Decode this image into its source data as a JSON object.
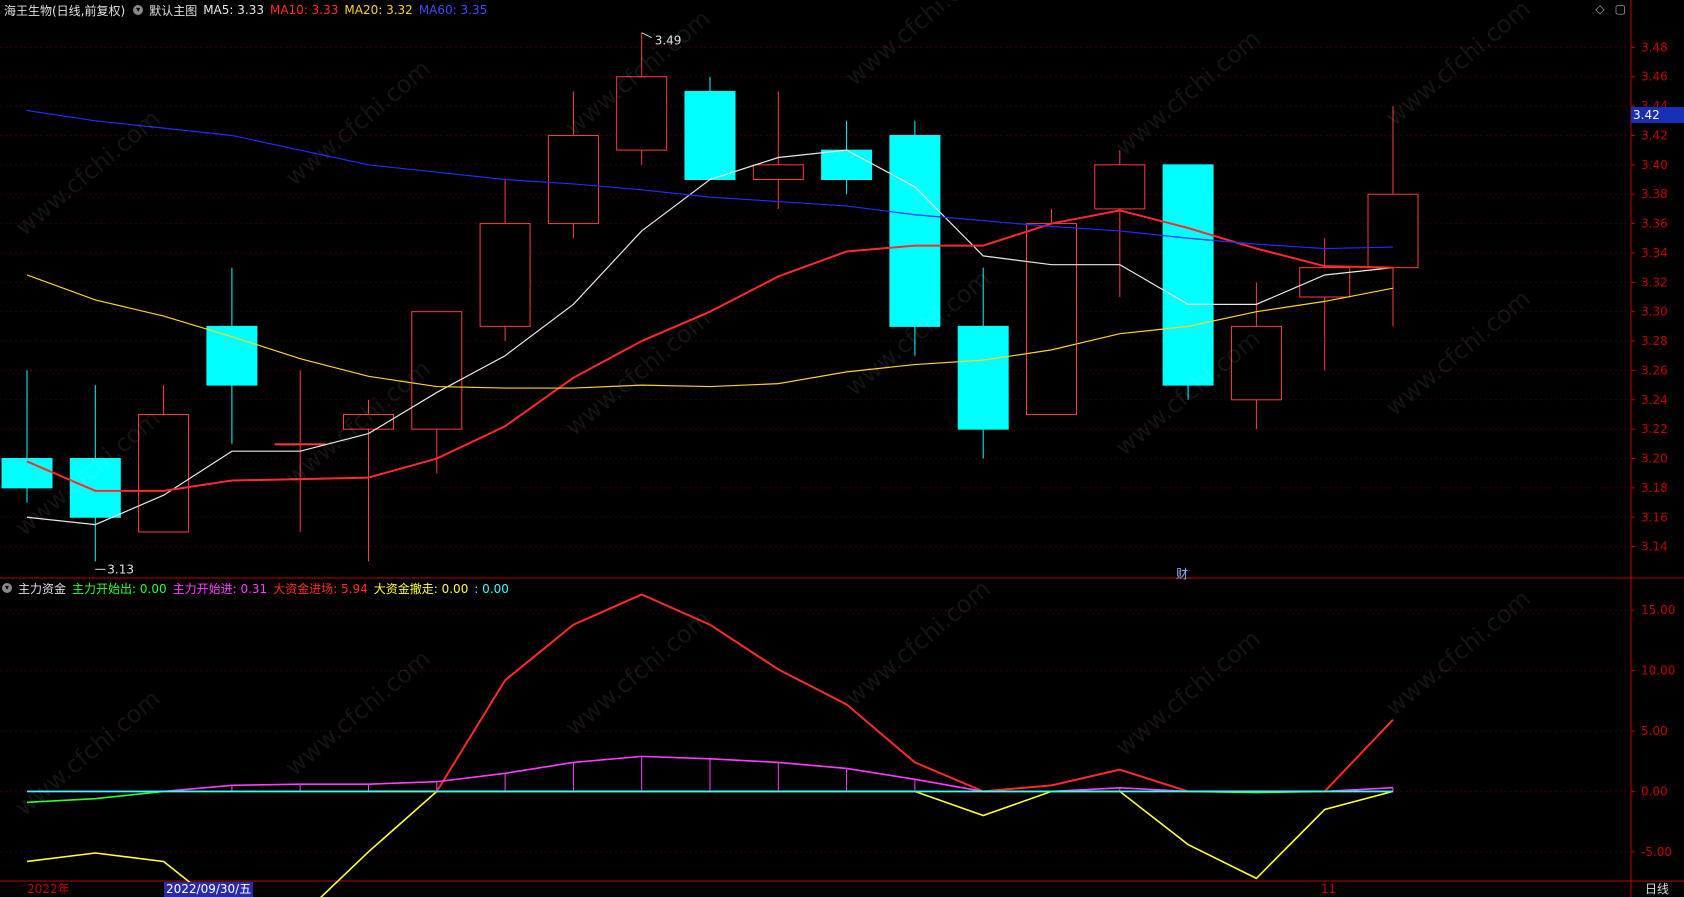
{
  "header": {
    "stock": "海王生物(日线,前复权)",
    "main_indicator": "默认主图",
    "ma_items": [
      {
        "label": "MA5: 3.33",
        "color": "#e8e8e8"
      },
      {
        "label": "MA10: 3.33",
        "color": "#ff2a2a"
      },
      {
        "label": "MA20: 3.32",
        "color": "#ffd21e"
      },
      {
        "label": "MA60: 3.35",
        "color": "#3a4cff"
      }
    ],
    "icons": [
      "diamond-icon",
      "window-icon"
    ]
  },
  "sub_header": {
    "indicator": "主力资金",
    "items": [
      {
        "label": "主力开始出: 0.00",
        "color": "#2dff2d"
      },
      {
        "label": "主力开始进: 0.31",
        "color": "#ff3cff"
      },
      {
        "label": "大资金进场: 5.94",
        "color": "#ff2a2a"
      },
      {
        "label": "大资金撤走: 0.00",
        "color": "#ffff33"
      },
      {
        "label": ": 0.00",
        "color": "#33ffff"
      }
    ]
  },
  "current_price": "3.42",
  "high_label": "3.49",
  "low_label": "3.13",
  "finance_marker": "财",
  "bottom": {
    "year_label": "2022年",
    "selected_date": "2022/09/30/五",
    "month_label": "11",
    "period": "日线"
  },
  "watermark": "www.cfchi.com",
  "colors": {
    "up": "#ff3b3b",
    "down": "#00ffff",
    "axis": "#c00000",
    "grid": "#3a0000"
  },
  "chart_data": [
    {
      "type": "candlestick",
      "title": "海王生物(日线,前复权)",
      "ylim": [
        3.12,
        3.5
      ],
      "yticks": [
        "3.14",
        "3.16",
        "3.18",
        "3.20",
        "3.22",
        "3.24",
        "3.26",
        "3.28",
        "3.30",
        "3.32",
        "3.34",
        "3.36",
        "3.38",
        "3.40",
        "3.42",
        "3.44",
        "3.46",
        "3.48"
      ],
      "candles": [
        {
          "o": 3.2,
          "h": 3.26,
          "l": 3.17,
          "c": 3.18
        },
        {
          "o": 3.2,
          "h": 3.25,
          "l": 3.13,
          "c": 3.16
        },
        {
          "o": 3.15,
          "h": 3.25,
          "l": 3.15,
          "c": 3.23
        },
        {
          "o": 3.29,
          "h": 3.33,
          "l": 3.21,
          "c": 3.25
        },
        {
          "o": 3.21,
          "h": 3.26,
          "l": 3.15,
          "c": 3.21
        },
        {
          "o": 3.22,
          "h": 3.24,
          "l": 3.13,
          "c": 3.23
        },
        {
          "o": 3.22,
          "h": 3.3,
          "l": 3.19,
          "c": 3.3
        },
        {
          "o": 3.29,
          "h": 3.39,
          "l": 3.28,
          "c": 3.36
        },
        {
          "o": 3.36,
          "h": 3.45,
          "l": 3.35,
          "c": 3.42
        },
        {
          "o": 3.41,
          "h": 3.49,
          "l": 3.4,
          "c": 3.46
        },
        {
          "o": 3.45,
          "h": 3.46,
          "l": 3.39,
          "c": 3.39
        },
        {
          "o": 3.39,
          "h": 3.45,
          "l": 3.37,
          "c": 3.4
        },
        {
          "o": 3.41,
          "h": 3.43,
          "l": 3.38,
          "c": 3.39
        },
        {
          "o": 3.42,
          "h": 3.43,
          "l": 3.27,
          "c": 3.29
        },
        {
          "o": 3.29,
          "h": 3.33,
          "l": 3.2,
          "c": 3.22
        },
        {
          "o": 3.23,
          "h": 3.37,
          "l": 3.23,
          "c": 3.36
        },
        {
          "o": 3.37,
          "h": 3.41,
          "l": 3.31,
          "c": 3.4
        },
        {
          "o": 3.4,
          "h": 3.4,
          "l": 3.24,
          "c": 3.25
        },
        {
          "o": 3.24,
          "h": 3.32,
          "l": 3.22,
          "c": 3.29
        },
        {
          "o": 3.31,
          "h": 3.35,
          "l": 3.26,
          "c": 3.33
        },
        {
          "o": 3.33,
          "h": 3.44,
          "l": 3.29,
          "c": 3.38
        }
      ],
      "series": [
        {
          "name": "MA5",
          "color": "#e8e8e8",
          "values": [
            3.16,
            3.155,
            3.175,
            3.205,
            3.205,
            3.217,
            3.245,
            3.27,
            3.305,
            3.355,
            3.39,
            3.405,
            3.41,
            3.385,
            3.338,
            3.332,
            3.332,
            3.305,
            3.305,
            3.325,
            3.33
          ]
        },
        {
          "name": "MA10",
          "color": "#ff2a2a",
          "values": [
            3.198,
            3.178,
            3.178,
            3.185,
            3.186,
            3.187,
            3.2,
            3.222,
            3.255,
            3.28,
            3.3,
            3.324,
            3.341,
            3.345,
            3.345,
            3.36,
            3.369,
            3.357,
            3.343,
            3.331,
            3.33
          ]
        },
        {
          "name": "MA20",
          "color": "#ffd21e",
          "values": [
            3.325,
            3.308,
            3.297,
            3.283,
            3.268,
            3.256,
            3.249,
            3.248,
            3.248,
            3.25,
            3.249,
            3.251,
            3.259,
            3.264,
            3.267,
            3.274,
            3.285,
            3.29,
            3.3,
            3.307,
            3.316
          ]
        },
        {
          "name": "MA60",
          "color": "#1e2cff",
          "points": [
            [
              0,
              3.437
            ],
            [
              1,
              3.43
            ],
            [
              2,
              3.425
            ],
            [
              3,
              3.42
            ],
            [
              4,
              3.41
            ],
            [
              5,
              3.4
            ],
            [
              6,
              3.395
            ],
            [
              7,
              3.39
            ],
            [
              8,
              3.387
            ],
            [
              9,
              3.383
            ],
            [
              10,
              3.378
            ],
            [
              11,
              3.375
            ],
            [
              12,
              3.372
            ],
            [
              13,
              3.366
            ],
            [
              14,
              3.362
            ],
            [
              15,
              3.358
            ],
            [
              16,
              3.355
            ],
            [
              17,
              3.35
            ],
            [
              18,
              3.346
            ],
            [
              19,
              3.343
            ],
            [
              20,
              3.344
            ]
          ]
        }
      ]
    },
    {
      "type": "line",
      "title": "主力资金",
      "ylim": [
        -7.5,
        17.5
      ],
      "yticks": [
        "-5.00",
        "0.00",
        "5.00",
        "10.00",
        "15.00"
      ],
      "series": [
        {
          "name": "大资金进场",
          "color": "#ff2a2a",
          "values": [
            null,
            null,
            null,
            null,
            null,
            0,
            0,
            9.2,
            13.8,
            16.3,
            13.8,
            10.1,
            7.2,
            2.4,
            0,
            0.5,
            1.8,
            0,
            0,
            0,
            5.94
          ]
        },
        {
          "name": "主力开始进",
          "color": "#ff3cff",
          "values": [
            0,
            0,
            0,
            0.5,
            0.6,
            0.6,
            0.8,
            1.5,
            2.4,
            2.9,
            2.7,
            2.4,
            1.9,
            1.0,
            0,
            0,
            0.3,
            0,
            0,
            0,
            0.31
          ]
        },
        {
          "name": "大资金撤走",
          "color": "#ffff33",
          "values": [
            -5.8,
            -5.1,
            -5.8,
            -10.3,
            -10.4,
            -5.0,
            0,
            0,
            0,
            0,
            0,
            0,
            0,
            0,
            -2.0,
            0,
            0,
            -4.4,
            -7.2,
            -1.5,
            0
          ]
        },
        {
          "name": "主力开始出",
          "color": "#2dff2d",
          "values": [
            -0.9,
            -0.6,
            0,
            0,
            0,
            0,
            0,
            0,
            0,
            0,
            0,
            0,
            0,
            0,
            0,
            0,
            0,
            0,
            -0.1,
            0,
            0
          ]
        },
        {
          "name": "",
          "color": "#33ffff",
          "values": [
            0,
            0,
            0,
            0,
            0,
            0,
            0,
            0,
            0,
            0,
            0,
            0,
            0,
            0,
            0,
            0,
            0,
            0,
            0,
            0,
            0
          ]
        }
      ]
    }
  ]
}
